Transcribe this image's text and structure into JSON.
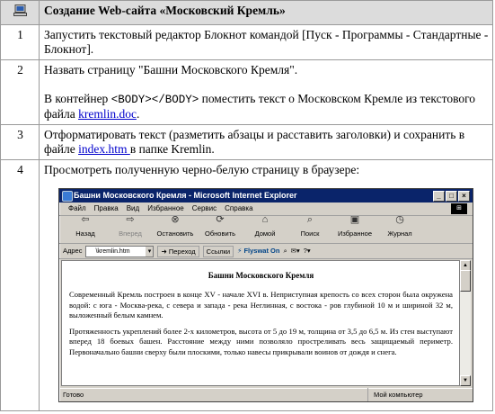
{
  "header": {
    "title": "Создание Web-сайта «Московский Кремль»"
  },
  "steps": [
    {
      "num": "1",
      "text": "Запустить текстовый редактор Блокнот командой [Пуск - Программы - Стандартные - Блокнот]."
    },
    {
      "num": "2",
      "line1": "Назвать страницу \"Башни Московского Кремля\".",
      "line2a": "В контейнер ",
      "tag": "<BODY></BODY>",
      "line2b": " поместить текст о Московском Кремле из текстового файла ",
      "link": "kremlin.doc",
      "after_link": "."
    },
    {
      "num": "3",
      "text_a": "Отформатировать текст (разметить абзацы и расставить заголовки) и сохранить в файле ",
      "link": "index.htm ",
      "text_b": "в папке Kremlin."
    },
    {
      "num": "4",
      "text": "Просмотреть полученную черно-белую страницу в браузере:"
    }
  ],
  "browser": {
    "title": "Башни Московского Кремля - Microsoft Internet Explorer",
    "menu": [
      "Файл",
      "Правка",
      "Вид",
      "Избранное",
      "Сервис",
      "Справка"
    ],
    "toolbar": [
      {
        "label": "Назад",
        "icon": "back-arrow-icon"
      },
      {
        "label": "Вперед",
        "icon": "forward-arrow-icon"
      },
      {
        "label": "Остановить",
        "icon": "stop-icon"
      },
      {
        "label": "Обновить",
        "icon": "refresh-icon"
      },
      {
        "label": "Домой",
        "icon": "home-icon"
      },
      {
        "label": "Поиск",
        "icon": "search-icon"
      },
      {
        "label": "Избранное",
        "icon": "favorites-icon"
      },
      {
        "label": "Журнал",
        "icon": "history-icon"
      }
    ],
    "address_label": "Адрес",
    "address_value": "\\kremlin.htm",
    "go_label": "Переход",
    "links_label": "Ссылки",
    "flyswat_label": "Flyswat On",
    "page": {
      "heading": "Башни Московского Кремля",
      "para1": "Современный Кремль построен в конце XV - начале XVI в. Неприступная крепость со всех сторон была окружена водой: с юга - Москва-река, с севера и запада - река Неглинная, с востока - ров глубиной 10 м и шириной 32 м, выложенный белым камнем.",
      "para2": "Протяженность укреплений более 2-х километров, высота от 5 до 19 м, толщина от 3,5 до 6,5 м. Из стен выступают вперед 18 боевых башен. Расстояние между ними позволяло простреливать весь защищаемый периметр. Первоначально башни сверху были плоскими, только навесы прикрывали воинов от дождя и снега."
    },
    "status_left": "Готово",
    "status_right": "Мой компьютер"
  }
}
